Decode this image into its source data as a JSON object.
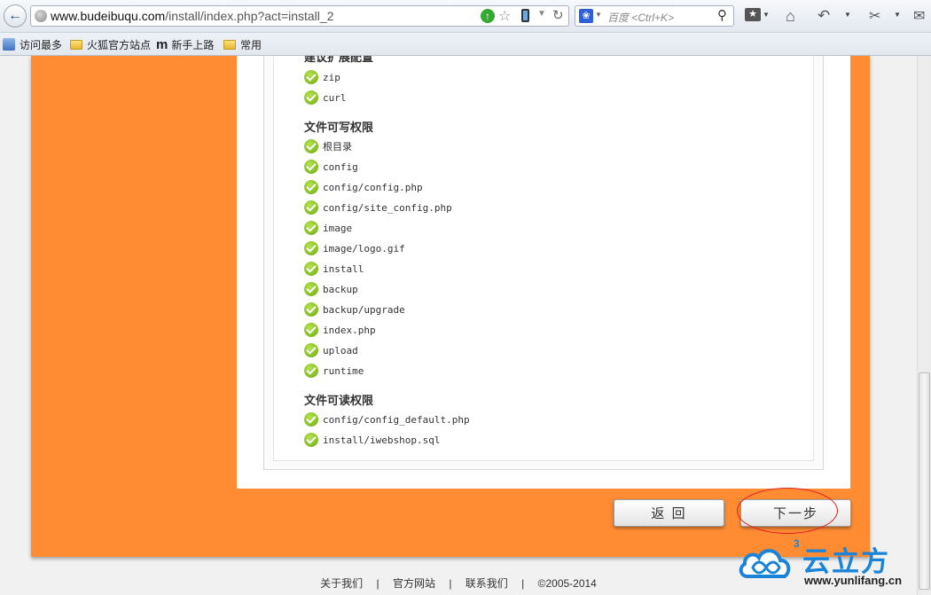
{
  "browser": {
    "url_host": "www.budeibuqu.com",
    "url_path": "/install/index.php?act=install_2",
    "search_placeholder": "百度 <Ctrl+K>",
    "bookmarks": [
      "访问最多",
      "火狐官方站点",
      "新手上路",
      "常用"
    ]
  },
  "install": {
    "truncated_heading": "建议扩展配置",
    "extensions": [
      "zip",
      "curl"
    ],
    "writable_title": "文件可写权限",
    "writable": [
      "根目录",
      "config",
      "config/config.php",
      "config/site_config.php",
      "image",
      "image/logo.gif",
      "install",
      "backup",
      "backup/upgrade",
      "index.php",
      "upload",
      "runtime"
    ],
    "readable_title": "文件可读权限",
    "readable": [
      "config/config_default.php",
      "install/iwebshop.sql"
    ],
    "back_label": "返 回",
    "next_label": "下一步"
  },
  "footer": {
    "links": [
      "关于我们",
      "官方网站",
      "联系我们"
    ],
    "separator": "|",
    "copyright": "©2005-2014"
  },
  "watermark": {
    "brand": "云立方",
    "domain": "www.yunlifang.cn",
    "badge": "3"
  },
  "colors": {
    "accent_orange": "#ff8b33",
    "check_green": "#6aa910",
    "annotation_red": "#e02020"
  }
}
